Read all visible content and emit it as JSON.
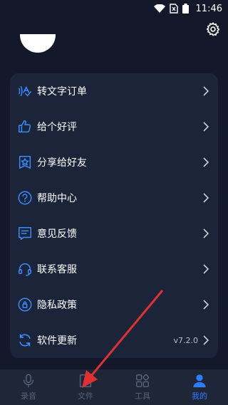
{
  "status_bar": {
    "time": "11:46"
  },
  "menu": {
    "items": [
      {
        "label": "转文字订单",
        "icon": "transcribe-icon"
      },
      {
        "label": "给个好评",
        "icon": "thumbs-up-icon"
      },
      {
        "label": "分享给好友",
        "icon": "share-star-icon"
      },
      {
        "label": "帮助中心",
        "icon": "help-icon"
      },
      {
        "label": "意见反馈",
        "icon": "feedback-icon"
      },
      {
        "label": "联系客服",
        "icon": "headset-icon"
      },
      {
        "label": "隐私政策",
        "icon": "privacy-icon"
      },
      {
        "label": "软件更新",
        "icon": "refresh-icon",
        "version": "v7.2.0"
      }
    ]
  },
  "tabbar": {
    "tabs": [
      {
        "label": "录音",
        "icon": "microphone-icon",
        "active": false
      },
      {
        "label": "文件",
        "icon": "file-icon",
        "active": false
      },
      {
        "label": "工具",
        "icon": "tools-icon",
        "active": false
      },
      {
        "label": "我的",
        "icon": "profile-icon",
        "active": true
      }
    ]
  },
  "colors": {
    "background": "#13192b",
    "card": "#1b2438",
    "icon_blue": "#3a8dff",
    "active_tab": "#2e7cff",
    "inactive_tab": "#566279",
    "annotation_arrow": "#e03131"
  }
}
